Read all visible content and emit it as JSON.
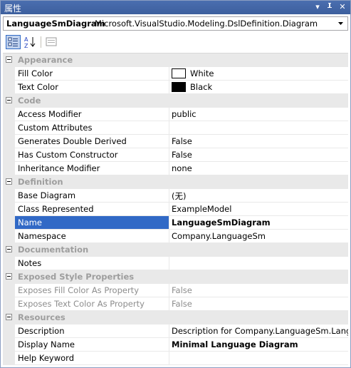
{
  "window": {
    "title": "属性"
  },
  "selector": {
    "object_name": "LanguageSmDiagram",
    "object_type": "Microsoft.VisualStudio.Modeling.DslDefinition.Diagram"
  },
  "categories": {
    "appearance": {
      "label": "Appearance",
      "fill_color": {
        "name": "Fill Color",
        "value": "White",
        "swatch": "#ffffff"
      },
      "text_color": {
        "name": "Text Color",
        "value": "Black",
        "swatch": "#000000"
      }
    },
    "code": {
      "label": "Code",
      "access_modifier": {
        "name": "Access Modifier",
        "value": "public"
      },
      "custom_attributes": {
        "name": "Custom Attributes",
        "value": ""
      },
      "generates_double_derived": {
        "name": "Generates Double Derived",
        "value": "False"
      },
      "has_custom_constructor": {
        "name": "Has Custom Constructor",
        "value": "False"
      },
      "inheritance_modifier": {
        "name": "Inheritance Modifier",
        "value": "none"
      }
    },
    "definition": {
      "label": "Definition",
      "base_diagram": {
        "name": "Base Diagram",
        "value": "(无)"
      },
      "class_represented": {
        "name": "Class Represented",
        "value": "ExampleModel"
      },
      "name": {
        "name": "Name",
        "value": "LanguageSmDiagram"
      },
      "namespace": {
        "name": "Namespace",
        "value": "Company.LanguageSm"
      }
    },
    "documentation": {
      "label": "Documentation",
      "notes": {
        "name": "Notes",
        "value": ""
      }
    },
    "exposed_style": {
      "label": "Exposed Style Properties",
      "exposes_fill": {
        "name": "Exposes Fill Color As Property",
        "value": "False"
      },
      "exposes_text": {
        "name": "Exposes Text Color As Property",
        "value": "False"
      }
    },
    "resources": {
      "label": "Resources",
      "description": {
        "name": "Description",
        "value": "Description for Company.LanguageSm.LanguageSmDiagram"
      },
      "display_name": {
        "name": "Display Name",
        "value": "Minimal Language Diagram"
      },
      "help_keyword": {
        "name": "Help Keyword",
        "value": ""
      }
    }
  },
  "colors": {
    "titlebar": "#4a6eaf",
    "selection": "#3169c6",
    "category_bg": "#e9e9e9"
  },
  "icons": [
    "dropdown-arrow-icon",
    "pin-icon",
    "close-icon",
    "categorized-icon",
    "alphabetical-icon",
    "property-pages-icon"
  ]
}
